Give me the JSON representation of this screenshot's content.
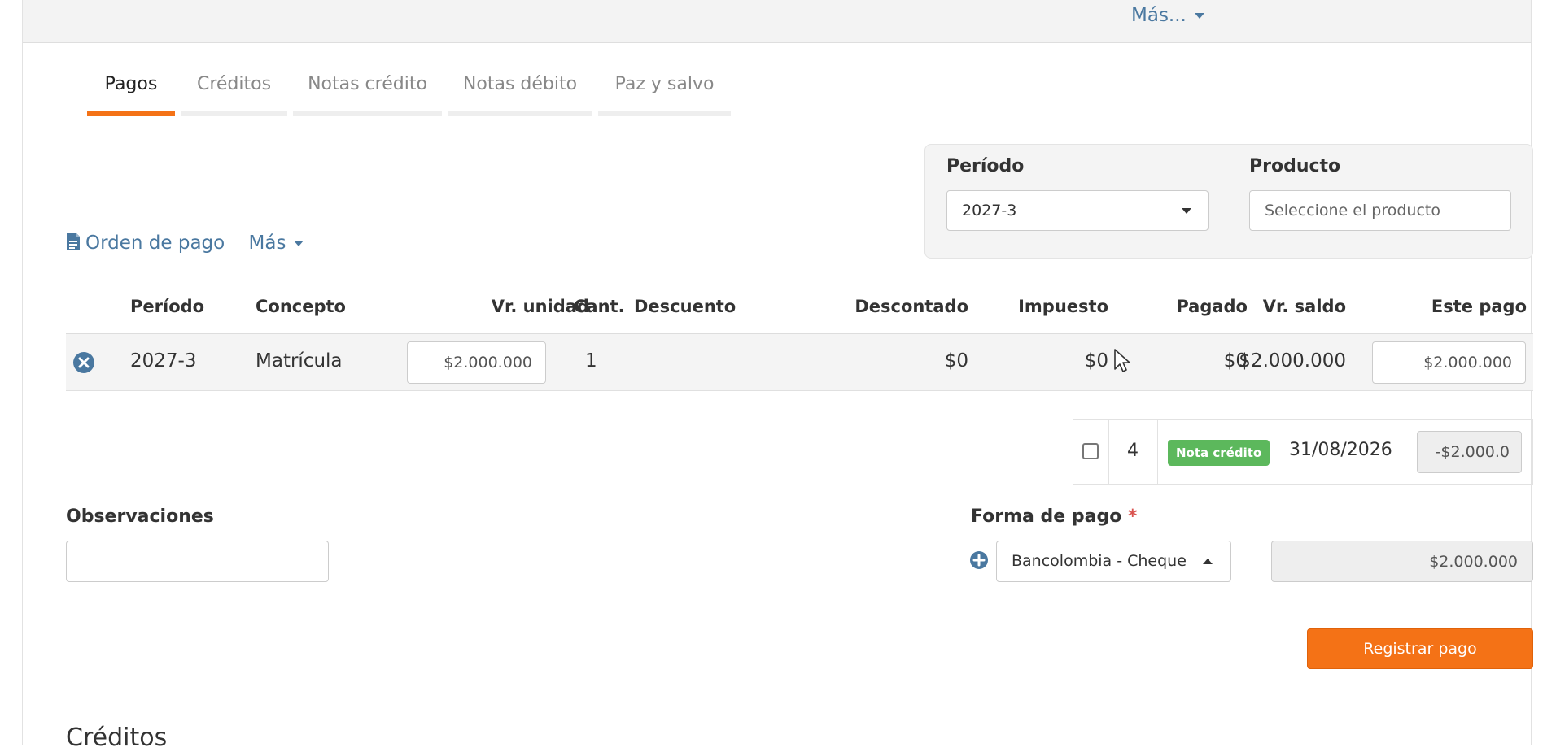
{
  "topbar": {
    "more_label": "Más..."
  },
  "tabs": [
    {
      "label": "Pagos",
      "active": true
    },
    {
      "label": "Créditos",
      "active": false
    },
    {
      "label": "Notas crédito",
      "active": false
    },
    {
      "label": "Notas débito",
      "active": false
    },
    {
      "label": "Paz y salvo",
      "active": false
    }
  ],
  "filters": {
    "period_label": "Período",
    "period_value": "2027-3",
    "product_label": "Producto",
    "product_placeholder": "Seleccione el producto"
  },
  "actions": {
    "payment_order": "Orden de pago",
    "more": "Más"
  },
  "table": {
    "headers": [
      "Período",
      "Concepto",
      "Vr. unidad",
      "Cant.",
      "Descuento",
      "Descontado",
      "Impuesto",
      "Pagado",
      "Vr. saldo",
      "Este pago"
    ],
    "rows": [
      {
        "period": "2027-3",
        "concept": "Matrícula",
        "unit_value": "$2.000.000",
        "quantity": "1",
        "discount": "",
        "discounted": "$0",
        "tax": "$0",
        "paid": "$0",
        "balance": "$2.000.000",
        "this_payment": "$2.000.000"
      }
    ]
  },
  "credit_note": {
    "checked": false,
    "number": "4",
    "badge": "Nota crédito",
    "date": "31/08/2026",
    "amount": "-$2.000.0"
  },
  "observations": {
    "label": "Observaciones",
    "value": ""
  },
  "payment_method": {
    "label": "Forma de pago",
    "required_mark": "*",
    "selected": "Bancolombia - Cheque",
    "amount": "$2.000.000"
  },
  "submit_label": "Registrar pago",
  "credits_section_title": "Créditos",
  "colors": {
    "accent": "#f47216",
    "link": "#4a78a0",
    "badge_green": "#5cb85c"
  }
}
